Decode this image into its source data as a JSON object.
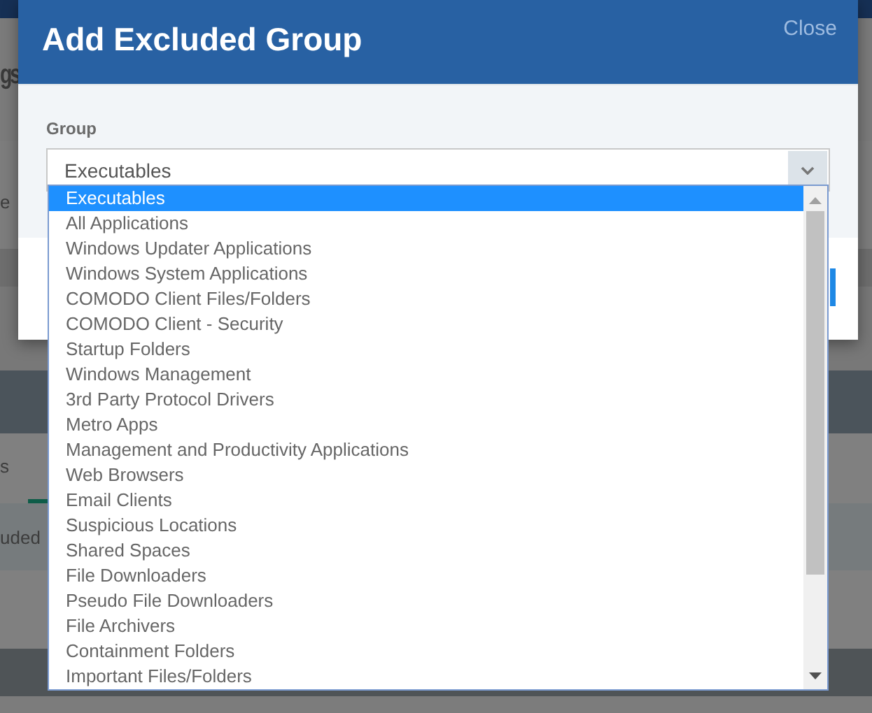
{
  "background": {
    "texts": [
      "gs",
      "e",
      "s",
      "uded"
    ]
  },
  "dialog": {
    "title": "Add Excluded Group",
    "close": "Close",
    "field": {
      "label": "Group",
      "value": "Executables",
      "expanded": true
    },
    "options": [
      {
        "label": "Executables",
        "selected": true
      },
      {
        "label": "All Applications",
        "selected": false
      },
      {
        "label": "Windows Updater Applications",
        "selected": false
      },
      {
        "label": "Windows System Applications",
        "selected": false
      },
      {
        "label": "COMODO Client Files/Folders",
        "selected": false
      },
      {
        "label": "COMODO Client - Security",
        "selected": false
      },
      {
        "label": "Startup Folders",
        "selected": false
      },
      {
        "label": "Windows Management",
        "selected": false
      },
      {
        "label": "3rd Party Protocol Drivers",
        "selected": false
      },
      {
        "label": "Metro Apps",
        "selected": false
      },
      {
        "label": "Management and Productivity Applications",
        "selected": false
      },
      {
        "label": "Web Browsers",
        "selected": false
      },
      {
        "label": "Email Clients",
        "selected": false
      },
      {
        "label": "Suspicious Locations",
        "selected": false
      },
      {
        "label": "Shared Spaces",
        "selected": false
      },
      {
        "label": "File Downloaders",
        "selected": false
      },
      {
        "label": "Pseudo File Downloaders",
        "selected": false
      },
      {
        "label": "File Archivers",
        "selected": false
      },
      {
        "label": "Containment Folders",
        "selected": false
      },
      {
        "label": "Important Files/Folders",
        "selected": false
      }
    ]
  }
}
